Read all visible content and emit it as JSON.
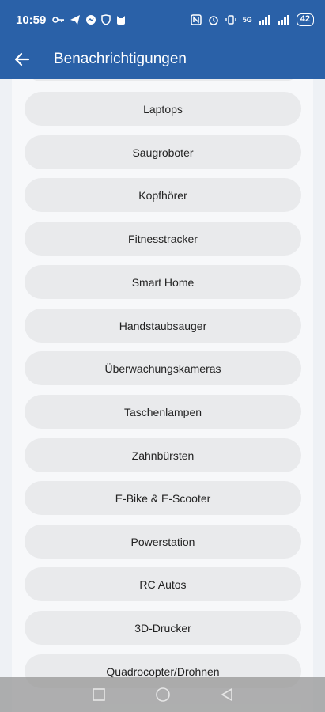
{
  "status_bar": {
    "time": "10:59",
    "network": "5G",
    "battery": "42"
  },
  "app_bar": {
    "title": "Benachrichtigungen"
  },
  "categories": [
    "Laptops",
    "Saugroboter",
    "Kopfhörer",
    "Fitnesstracker",
    "Smart Home",
    "Handstaubsauger",
    "Überwachungskameras",
    "Taschenlampen",
    "Zahnbürsten",
    "E-Bike & E-Scooter",
    "Powerstation",
    "RC Autos",
    "3D-Drucker",
    "Quadrocopter/Drohnen"
  ],
  "colors": {
    "accent": "#2a61a8",
    "item_bg": "#e9eaec",
    "content_bg": "#f7f8fa"
  }
}
